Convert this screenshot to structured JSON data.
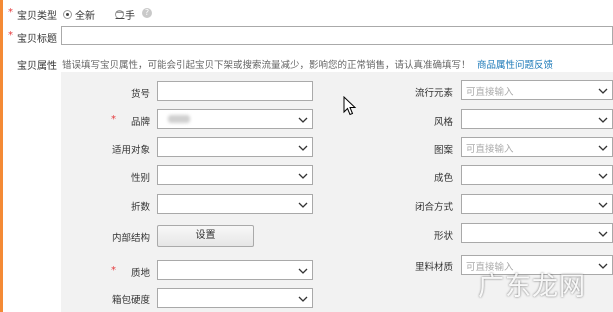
{
  "item_type": {
    "label": "宝贝类型",
    "options": [
      {
        "label": "全新",
        "selected": true
      },
      {
        "label": "二手",
        "selected": false
      }
    ],
    "help_icon": "question-circle-icon"
  },
  "item_title": {
    "label": "宝贝标题",
    "value": ""
  },
  "attributes": {
    "label": "宝贝属性",
    "hint": "错误填写宝贝属性，可能会引起宝贝下架或搜索流量减少，影响您的正常销售，请认真准确填写！",
    "feedback_link": "商品属性问题反馈",
    "left_fields": [
      {
        "label": "货号",
        "required": false,
        "kind": "text",
        "value": ""
      },
      {
        "label": "品牌",
        "required": true,
        "kind": "select",
        "value": ""
      },
      {
        "label": "适用对象",
        "required": false,
        "kind": "select",
        "value": ""
      },
      {
        "label": "性别",
        "required": false,
        "kind": "select",
        "value": ""
      },
      {
        "label": "折数",
        "required": false,
        "kind": "select",
        "value": ""
      },
      {
        "label": "内部结构",
        "required": false,
        "kind": "button",
        "button_label": "设置"
      },
      {
        "label": "质地",
        "required": true,
        "kind": "select",
        "value": ""
      },
      {
        "label": "箱包硬度",
        "required": false,
        "kind": "select",
        "value": ""
      }
    ],
    "right_fields": [
      {
        "label": "流行元素",
        "placeholder": "可直接输入"
      },
      {
        "label": "风格",
        "placeholder": ""
      },
      {
        "label": "图案",
        "placeholder": "可直接输入"
      },
      {
        "label": "成色",
        "placeholder": ""
      },
      {
        "label": "闭合方式",
        "placeholder": ""
      },
      {
        "label": "形状",
        "placeholder": ""
      },
      {
        "label": "里料材质",
        "placeholder": "可直接输入"
      }
    ]
  },
  "watermark": "广东龙网",
  "colors": {
    "required": "#e4393c",
    "link": "#1b79b8",
    "accent_bar": "#f48a35",
    "panel_bg": "#f2f2f2"
  }
}
